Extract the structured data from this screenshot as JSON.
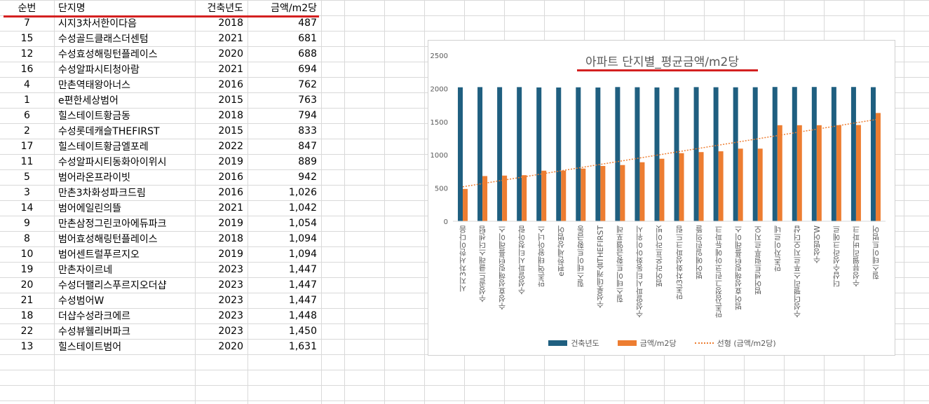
{
  "sheet": {
    "headers": [
      "순번",
      "단지명",
      "건축년도",
      "금액/m2당"
    ],
    "rows": [
      [
        "7",
        "시지3차서한이다음",
        "2018",
        "487"
      ],
      [
        "15",
        "수성골드클래스더센텀",
        "2021",
        "681"
      ],
      [
        "12",
        "수성효성해링턴플레이스",
        "2020",
        "688"
      ],
      [
        "16",
        "수성알파시티청아람",
        "2021",
        "694"
      ],
      [
        "4",
        "만촌역태왕아너스",
        "2016",
        "762"
      ],
      [
        "1",
        "e편한세상범어",
        "2015",
        "763"
      ],
      [
        "6",
        "힐스테이트황금동",
        "2018",
        "794"
      ],
      [
        "2",
        "수성롯데캐슬THEFIRST",
        "2015",
        "833"
      ],
      [
        "17",
        "힐스테이트황금엘포레",
        "2022",
        "847"
      ],
      [
        "11",
        "수성알파시티동화아이위시",
        "2019",
        "889"
      ],
      [
        "5",
        "범어라온프라이빗",
        "2016",
        "942"
      ],
      [
        "3",
        "만촌3차화성파크드림",
        "2016",
        "1,026"
      ],
      [
        "14",
        "범어에일린의뜰",
        "2021",
        "1,042"
      ],
      [
        "9",
        "만촌삼정그린코아에듀파크",
        "2019",
        "1,054"
      ],
      [
        "8",
        "범어효성해링턴플레이스",
        "2018",
        "1,094"
      ],
      [
        "10",
        "범어센트럴푸르지오",
        "2019",
        "1,094"
      ],
      [
        "19",
        "만촌자이르네",
        "2023",
        "1,447"
      ],
      [
        "20",
        "수성더팰리스푸르지오더샵",
        "2023",
        "1,447"
      ],
      [
        "21",
        "수성범어W",
        "2023",
        "1,447"
      ],
      [
        "18",
        "더샵수성라크에르",
        "2023",
        "1,448"
      ],
      [
        "22",
        "수성뷰웰리버파크",
        "2023",
        "1,450"
      ],
      [
        "13",
        "힐스테이트범어",
        "2020",
        "1,631"
      ]
    ]
  },
  "chart_data": {
    "type": "bar",
    "title": "아파트 단지별_평균금액/m2당",
    "categories": [
      "시지3차서한이다음",
      "수성골드클래스더센텀",
      "수성효성해링턴플레이스",
      "수성알파시티청아람",
      "만촌역태왕아너스",
      "e편한세상범어",
      "힐스테이트황금동",
      "수성롯데캐슬THEFIRST",
      "힐스테이트황금엘포레",
      "수성알파시티동화아이위시",
      "범어라온프라이빗",
      "만촌3차화성파크드림",
      "범어에일린의뜰",
      "만촌삼정그린코아에듀파크",
      "범어효성해링턴플레이스",
      "범어센트럴푸르지오",
      "만촌자이르네",
      "수성더팰리스푸르지오더샵",
      "수성범어W",
      "더샵수성라크에르",
      "수성뷰웰리버파크",
      "힐스테이트범어"
    ],
    "series": [
      {
        "name": "건축년도",
        "color": "#1f5f80",
        "values": [
          2018,
          2021,
          2020,
          2021,
          2016,
          2015,
          2018,
          2015,
          2022,
          2019,
          2016,
          2016,
          2021,
          2019,
          2018,
          2019,
          2023,
          2023,
          2023,
          2023,
          2023,
          2020
        ]
      },
      {
        "name": "금액/m2당",
        "color": "#ed7d31",
        "values": [
          487,
          681,
          688,
          694,
          762,
          763,
          794,
          833,
          847,
          889,
          942,
          1026,
          1042,
          1054,
          1094,
          1094,
          1447,
          1447,
          1447,
          1448,
          1450,
          1631
        ]
      }
    ],
    "trendline": {
      "name": "선형 (금액/m2당)",
      "type": "linear",
      "series": "금액/m2당"
    },
    "yticks": [
      "0",
      "500",
      "1000",
      "1500",
      "2000",
      "2500"
    ],
    "ylim": [
      0,
      2500
    ],
    "legend": "bottom"
  }
}
